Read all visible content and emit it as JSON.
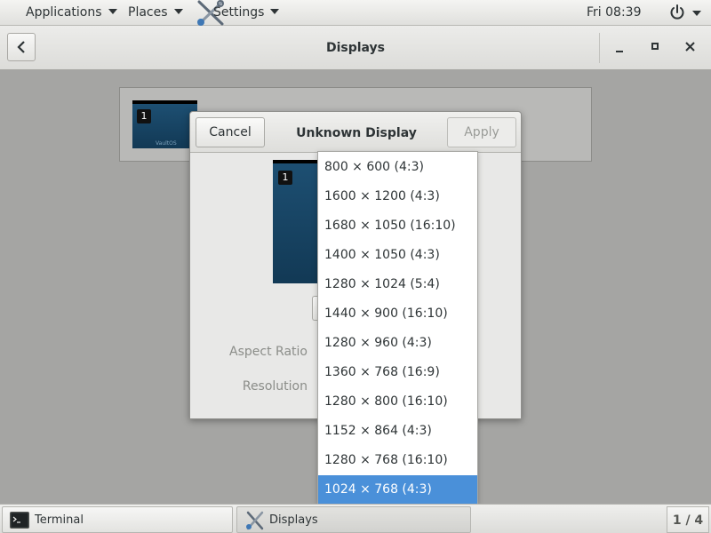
{
  "topbar": {
    "applications_label": "Applications",
    "places_label": "Places",
    "settings_label": "Settings",
    "clock": "Fri 08:39"
  },
  "headerbar": {
    "title": "Displays"
  },
  "arrangement": {
    "display_number": "1",
    "os_name": "VaultOS"
  },
  "dialog": {
    "title": "Unknown Display",
    "cancel_label": "Cancel",
    "apply_label": "Apply",
    "display_number": "1",
    "aspect_ratio_label": "Aspect Ratio",
    "resolution_label": "Resolution"
  },
  "dropdown": {
    "options": [
      "800 × 600 (4:3)",
      "1600 × 1200 (4:3)",
      "1680 × 1050 (16:10)",
      "1400 × 1050 (4:3)",
      "1280 × 1024 (5:4)",
      "1440 × 900 (16:10)",
      "1280 × 960 (4:3)",
      "1360 × 768 (16:9)",
      "1280 × 800 (16:10)",
      "1152 × 864 (4:3)",
      "1280 × 768 (16:10)",
      "1024 × 768 (4:3)"
    ],
    "selected": "1024 × 768 (4:3)"
  },
  "taskbar": {
    "terminal_label": "Terminal",
    "displays_label": "Displays",
    "workspace": "1 / 4"
  },
  "colors": {
    "selection": "#4a90d9",
    "background": "#a5a5a3",
    "display_thumbnail": "#1d4f72"
  }
}
